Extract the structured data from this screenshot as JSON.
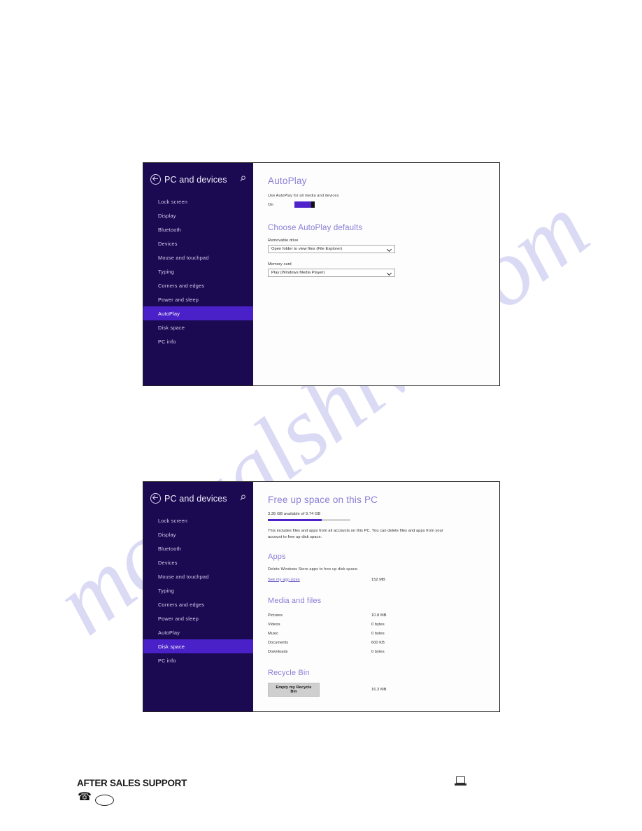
{
  "watermark": {
    "text": "manualshive.com"
  },
  "screenshot_autoplay": {
    "nav": {
      "title": "PC and devices",
      "back_icon": "back-arrow-icon",
      "search_icon": "search-icon",
      "items": [
        {
          "label": "Lock screen",
          "selected": false
        },
        {
          "label": "Display",
          "selected": false
        },
        {
          "label": "Bluetooth",
          "selected": false
        },
        {
          "label": "Devices",
          "selected": false
        },
        {
          "label": "Mouse and touchpad",
          "selected": false
        },
        {
          "label": "Typing",
          "selected": false
        },
        {
          "label": "Corners and edges",
          "selected": false
        },
        {
          "label": "Power and sleep",
          "selected": false
        },
        {
          "label": "AutoPlay",
          "selected": true
        },
        {
          "label": "Disk space",
          "selected": false
        },
        {
          "label": "PC info",
          "selected": false
        }
      ]
    },
    "content": {
      "heading": "AutoPlay",
      "toggle_caption": "Use AutoPlay for all media and devices",
      "toggle_state": "On",
      "defaults_heading": "Choose AutoPlay defaults",
      "removable_drive_label": "Removable drive",
      "removable_drive_value": "Open folder to view files (File Explorer)",
      "memory_card_label": "Memory card",
      "memory_card_value": "Play (Windows Media Player)"
    }
  },
  "screenshot_diskspace": {
    "nav": {
      "title": "PC and devices",
      "back_icon": "back-arrow-icon",
      "search_icon": "search-icon",
      "items": [
        {
          "label": "Lock screen",
          "selected": false
        },
        {
          "label": "Display",
          "selected": false
        },
        {
          "label": "Bluetooth",
          "selected": false
        },
        {
          "label": "Devices",
          "selected": false
        },
        {
          "label": "Mouse and touchpad",
          "selected": false
        },
        {
          "label": "Typing",
          "selected": false
        },
        {
          "label": "Corners and edges",
          "selected": false
        },
        {
          "label": "Power and sleep",
          "selected": false
        },
        {
          "label": "AutoPlay",
          "selected": false
        },
        {
          "label": "Disk space",
          "selected": true
        },
        {
          "label": "PC info",
          "selected": false
        }
      ]
    },
    "content": {
      "heading": "Free up space on this PC",
      "available_text": "3.35 GB available of 9.74 GB",
      "progress_percent": 65,
      "description": "This includes files and apps from all accounts on this PC. You can delete files and apps from your account to free up disk space.",
      "apps_heading": "Apps",
      "apps_description": "Delete Windows Store apps to free up disk space.",
      "app_sizes_link": "See my app sizes",
      "app_sizes_value": "152 MB",
      "media_heading": "Media and files",
      "media_rows": [
        {
          "label": "Pictures",
          "value": "10.8 MB"
        },
        {
          "label": "Videos",
          "value": "0 bytes"
        },
        {
          "label": "Music",
          "value": "0 bytes"
        },
        {
          "label": "Documents",
          "value": "600 KB"
        },
        {
          "label": "Downloads",
          "value": "0 bytes"
        }
      ],
      "recycle_heading": "Recycle Bin",
      "recycle_button": "Empty my Recycle Bin",
      "recycle_value": "16.3 MB"
    }
  },
  "footer": {
    "title": "AFTER SALES SUPPORT",
    "phone_icon": "telephone-icon",
    "oval_icon": "oval-outline-icon",
    "laptop_icon": "laptop-icon"
  },
  "colors": {
    "nav_background": "#1b0a51",
    "nav_selected": "#4a21c9",
    "accent": "#4e23c9",
    "heading": "#8a7fd6",
    "watermark": "#ccccf2"
  }
}
